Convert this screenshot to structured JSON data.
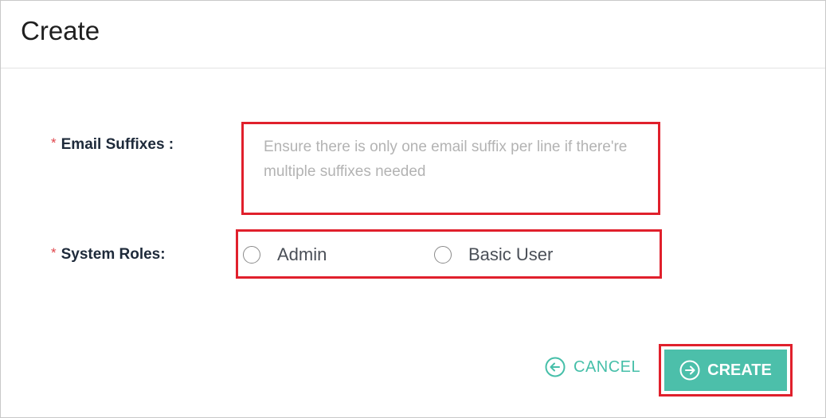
{
  "dialog": {
    "title": "Create"
  },
  "form": {
    "email_suffixes": {
      "required_marker": "*",
      "label": "Email Suffixes :",
      "value": "",
      "placeholder": "Ensure there is only one email suffix per line if there're multiple suffixes needed"
    },
    "system_roles": {
      "required_marker": "*",
      "label": "System Roles:",
      "options": [
        {
          "label": "Admin",
          "selected": false
        },
        {
          "label": "Basic User",
          "selected": false
        }
      ]
    }
  },
  "actions": {
    "cancel_label": "CANCEL",
    "create_label": "CREATE",
    "cancel_icon": "arrow-left-circle-icon",
    "create_icon": "arrow-right-circle-icon"
  },
  "colors": {
    "accent": "#4cbfaa",
    "highlight": "#e0202c",
    "required": "#e0454b"
  }
}
